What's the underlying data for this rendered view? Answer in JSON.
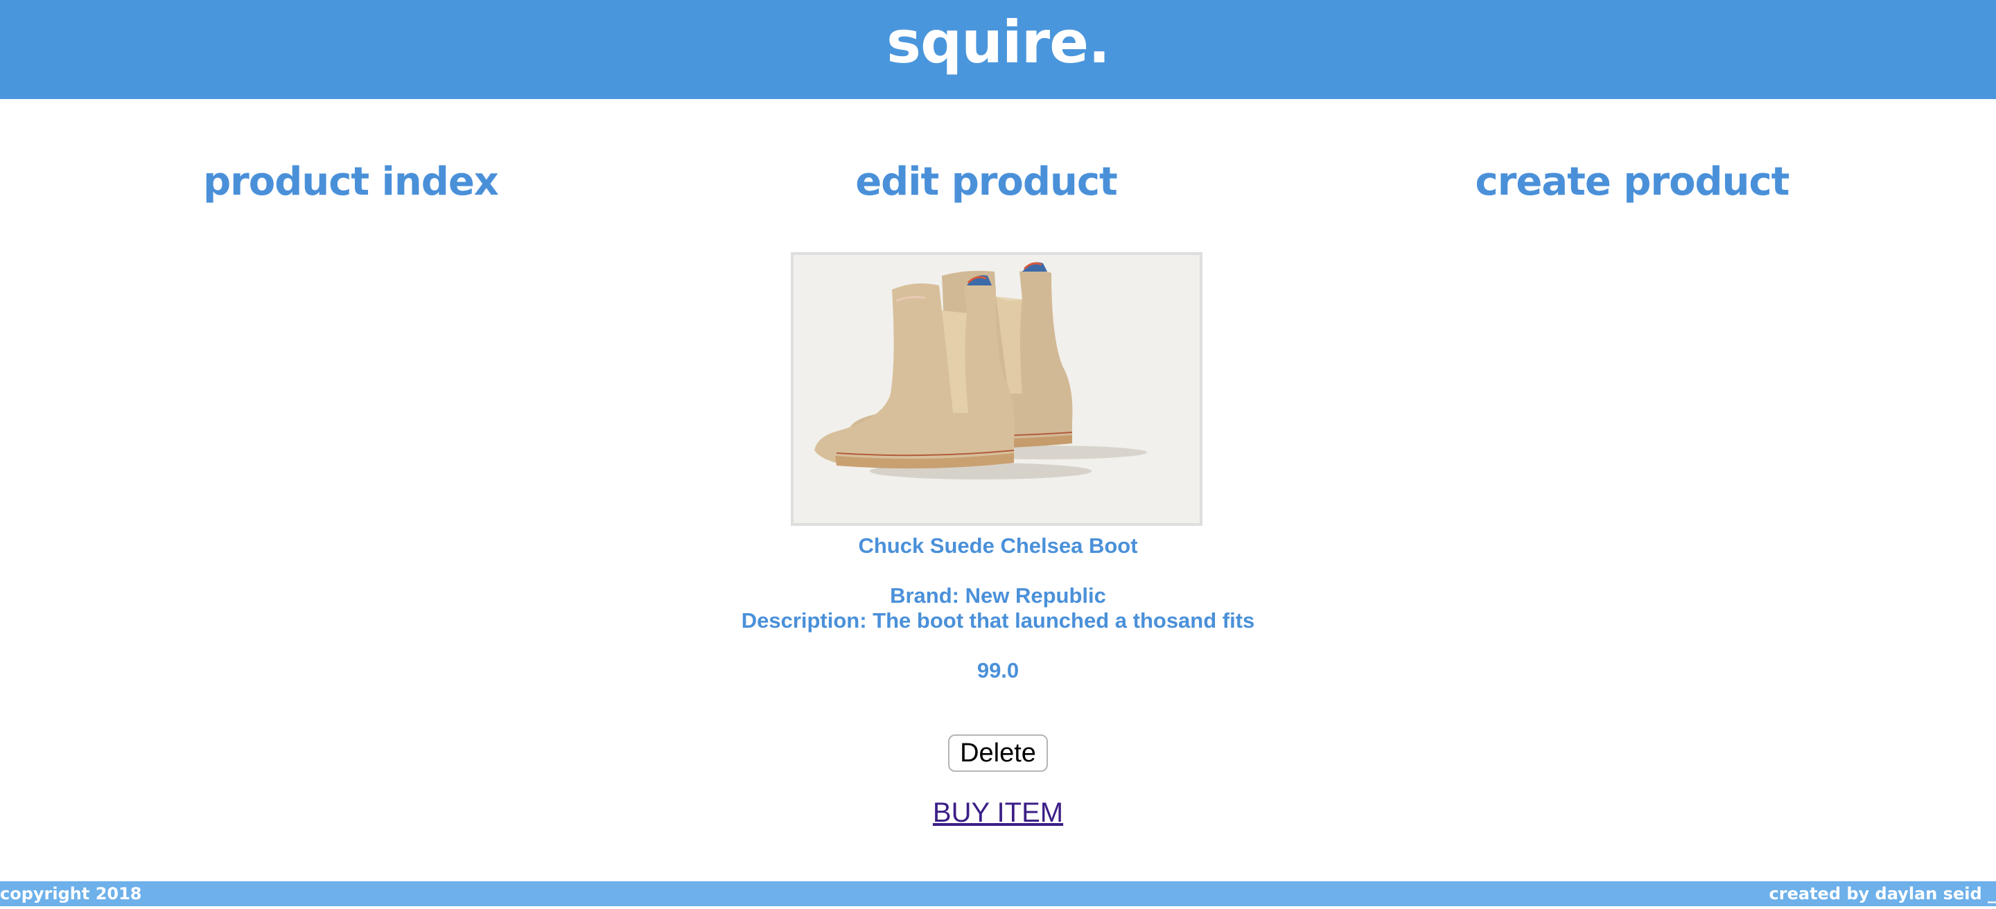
{
  "header": {
    "logo": "squire."
  },
  "nav": {
    "product_index": "product index",
    "edit_product": "edit product",
    "create_product": "create product"
  },
  "product": {
    "name": "Chuck Suede Chelsea Boot",
    "brand": "Brand: New Republic",
    "description": "Description: The boot that launched a thosand fits",
    "price": "99.0",
    "image_alt": "Chuck Suede Chelsea Boot"
  },
  "actions": {
    "delete_label": "Delete",
    "buy_label": "BUY ITEM"
  },
  "footer": {
    "copyright": "copyright 2018",
    "credit": "created by daylan seid _"
  },
  "colors": {
    "header_bg": "#4a96dc",
    "accent_text": "#4a90d9",
    "footer_bg": "#6db0ea",
    "link_visited": "#3b1f87"
  }
}
